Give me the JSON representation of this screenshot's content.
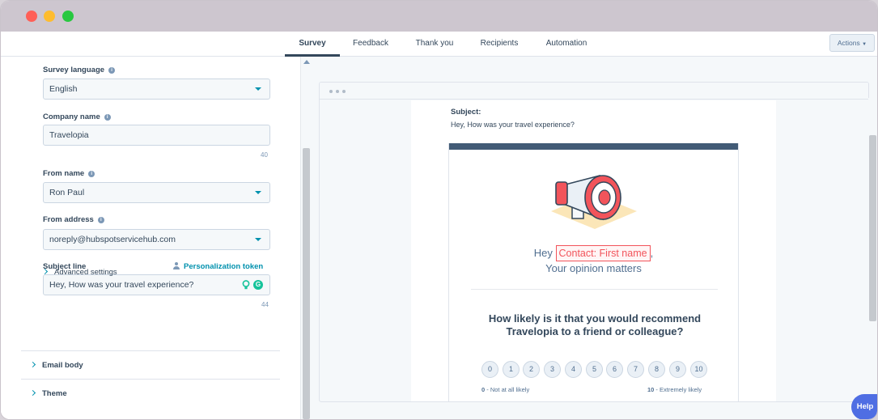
{
  "nav": {
    "tabs": [
      {
        "label": "Survey",
        "active": true
      },
      {
        "label": "Feedback"
      },
      {
        "label": "Thank you"
      },
      {
        "label": "Recipients"
      },
      {
        "label": "Automation"
      }
    ],
    "actions_label": "Actions"
  },
  "form": {
    "survey_language": {
      "label": "Survey language",
      "value": "English"
    },
    "company_name": {
      "label": "Company name",
      "value": "Travelopia",
      "counter": "40"
    },
    "from_name": {
      "label": "From name",
      "value": "Ron Paul"
    },
    "from_address": {
      "label": "From address",
      "value": "noreply@hubspotservicehub.com"
    },
    "subject_line": {
      "label": "Subject line",
      "value": "Hey, How was your travel experience?",
      "counter": "44",
      "token_link": "Personalization token"
    },
    "advanced_settings": "Advanced settings"
  },
  "sections": [
    "Email body",
    "Theme"
  ],
  "preview": {
    "subject_label": "Subject:",
    "subject_value": "Hey, How was your travel experience?",
    "greeting_prefix": "Hey",
    "greeting_token": "Contact: First name",
    "greeting_suffix": ",",
    "greeting_line2": "Your opinion matters",
    "question": "How likely is it that you would recommend Travelopia to a friend or colleague?",
    "scale": [
      "0",
      "1",
      "2",
      "3",
      "4",
      "5",
      "6",
      "7",
      "8",
      "9",
      "10"
    ],
    "low_num": "0",
    "low_text": " - Not at all likely",
    "high_num": "10",
    "high_text": " - Extremely likely"
  },
  "help_label": "Help",
  "colors": {
    "accent": "#0091ae",
    "token": "#f2545b",
    "help": "#4f6ee3",
    "header_bar": "#425b76"
  }
}
